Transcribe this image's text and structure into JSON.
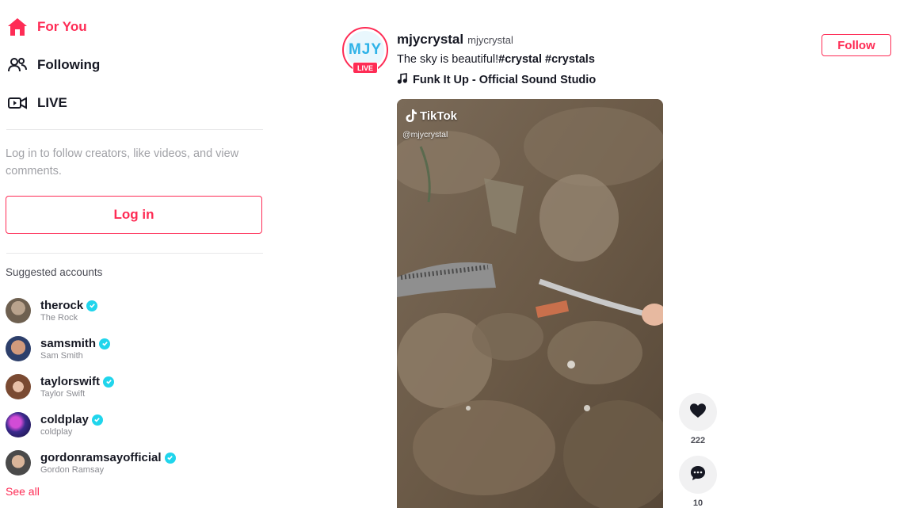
{
  "nav": {
    "for_you": "For You",
    "following": "Following",
    "live": "LIVE"
  },
  "login": {
    "hint": "Log in to follow creators, like videos, and view comments.",
    "button": "Log in"
  },
  "suggested": {
    "title": "Suggested accounts",
    "accounts": [
      {
        "handle": "therock",
        "name": "The Rock"
      },
      {
        "handle": "samsmith",
        "name": "Sam Smith"
      },
      {
        "handle": "taylorswift",
        "name": "Taylor Swift"
      },
      {
        "handle": "coldplay",
        "name": "coldplay"
      },
      {
        "handle": "gordonramsayofficial",
        "name": "Gordon Ramsay"
      }
    ],
    "see_all": "See all"
  },
  "post": {
    "avatar_text": "MJY",
    "live_badge": "LIVE",
    "author_handle": "mjycrystal",
    "author_nick": "mjycrystal",
    "caption_text": "The sky is beautiful!",
    "hashtags": [
      "#crystal",
      "#crystals"
    ],
    "music": "Funk It Up - Official Sound Studio",
    "follow": "Follow",
    "watermark_logo": "TikTok",
    "watermark_handle": "@mjycrystal",
    "likes": "222",
    "comments": "10"
  },
  "colors": {
    "accent": "#fe2c55",
    "verified": "#20d5ec"
  }
}
